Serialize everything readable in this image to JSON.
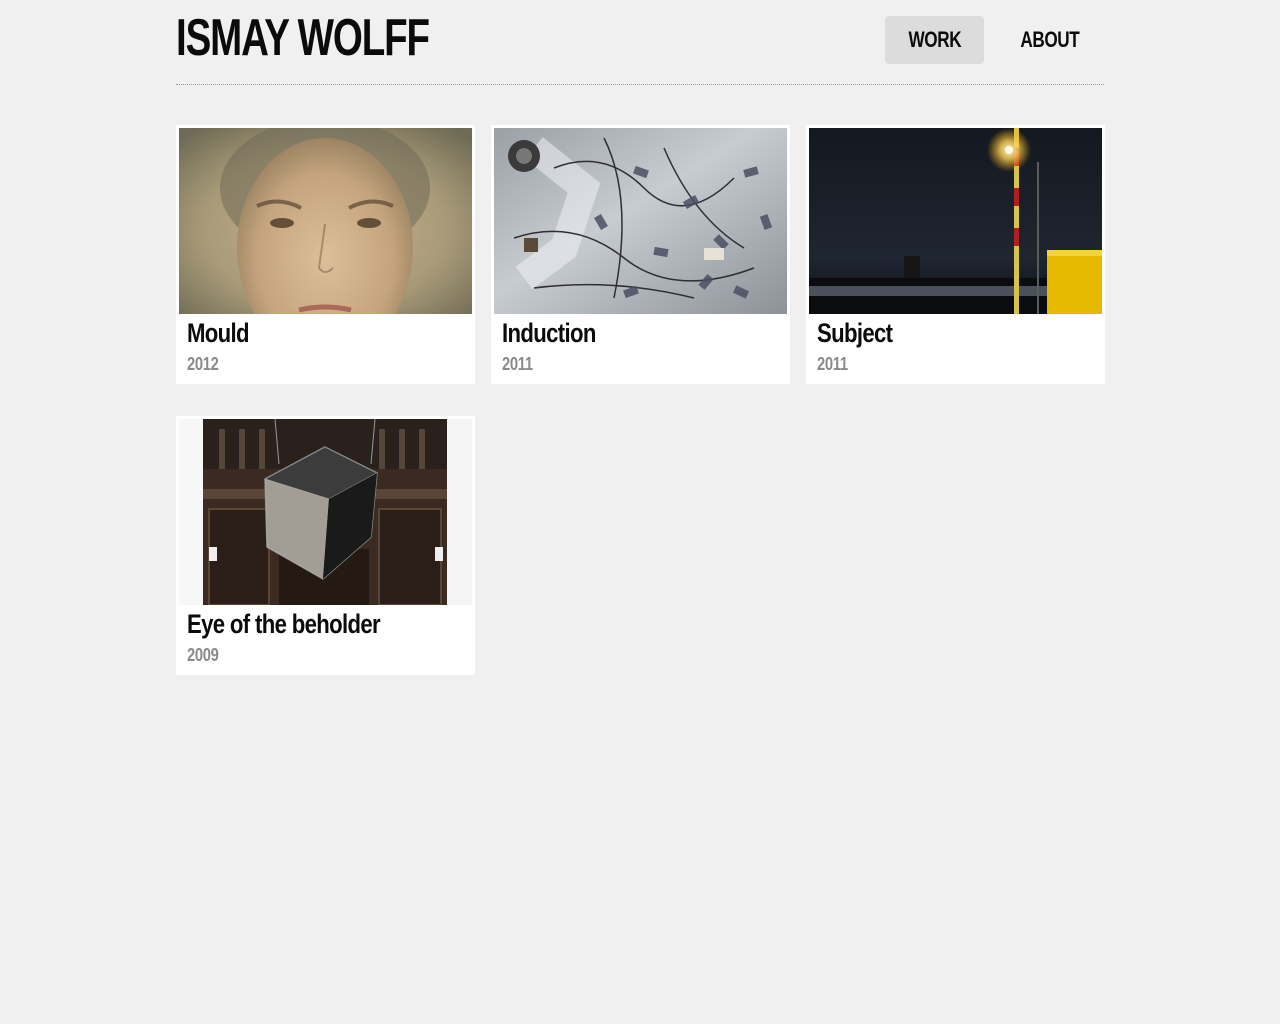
{
  "site": {
    "title": "ISMAY WOLFF"
  },
  "nav": {
    "items": [
      {
        "label": "WORK",
        "active": true
      },
      {
        "label": "ABOUT",
        "active": false
      }
    ]
  },
  "works": [
    {
      "title": "Mould",
      "year": "2012",
      "image": "face-portrait"
    },
    {
      "title": "Induction",
      "year": "2011",
      "image": "wires-on-floor"
    },
    {
      "title": "Subject",
      "year": "2011",
      "image": "night-streetlight"
    },
    {
      "title": "Eye of the beholder",
      "year": "2009",
      "image": "hanging-cube-in-church"
    }
  ],
  "colors": {
    "background": "#f0f0f0",
    "card": "#ffffff",
    "nav_active": "#dcdcdc",
    "year_text": "#8a8a8a"
  }
}
